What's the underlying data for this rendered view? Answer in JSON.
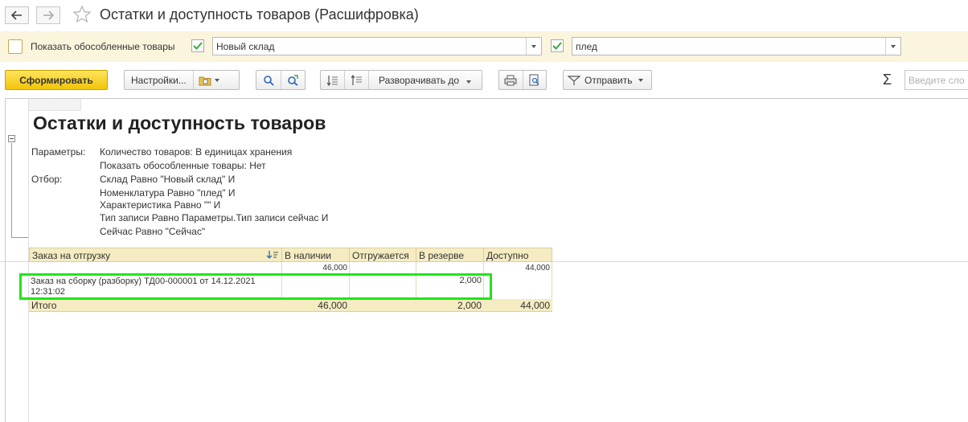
{
  "window": {
    "title": "Остатки и доступность товаров (Расшифровка)"
  },
  "filters": {
    "show_separate_label": "Показать обособленные товары",
    "show_separate_checked": false,
    "warehouse_checked": true,
    "warehouse_value": "Новый склад",
    "item_checked": true,
    "item_value": "плед"
  },
  "toolbar": {
    "generate_label": "Сформировать",
    "settings_label": "Настройки...",
    "expand_label": "Разворачивать до",
    "send_label": "Отправить",
    "sum_symbol": "Σ",
    "search_placeholder": "Введите сло"
  },
  "report": {
    "title": "Остатки и доступность товаров",
    "params_label": "Параметры:",
    "params": [
      "Количество товаров: В единицах хранения",
      "Показать обособленные товары: Нет"
    ],
    "filter_label": "Отбор:",
    "filter_lines": [
      "Склад Равно \"Новый склад\" И",
      "Номенклатура Равно \"плед\" И",
      "Характеристика Равно \"\" И",
      "Тип записи Равно Параметры.Тип записи сейчас И",
      "Сейчас Равно \"Сейчас\""
    ],
    "table": {
      "columns": [
        "Заказ на отгрузку",
        "В наличии",
        "Отгружается",
        "В резерве",
        "Доступно"
      ],
      "group_row": {
        "in_stock": "46,000",
        "available": "44,000"
      },
      "detail_row": {
        "order_line1": "Заказ на сборку (разборку) ТД00-000001 от 14.12.2021",
        "order_line2": "12:31:02",
        "reserve": "2,000"
      },
      "total_row": {
        "label": "Итого",
        "in_stock": "46,000",
        "reserve": "2,000",
        "available": "44,000"
      }
    }
  },
  "colors": {
    "header_bg": "#f5ecc2",
    "filter_bg": "#fbf5de",
    "primary_button": "#f1c50a",
    "highlight": "#22e51a",
    "check": "#3aa83a"
  }
}
